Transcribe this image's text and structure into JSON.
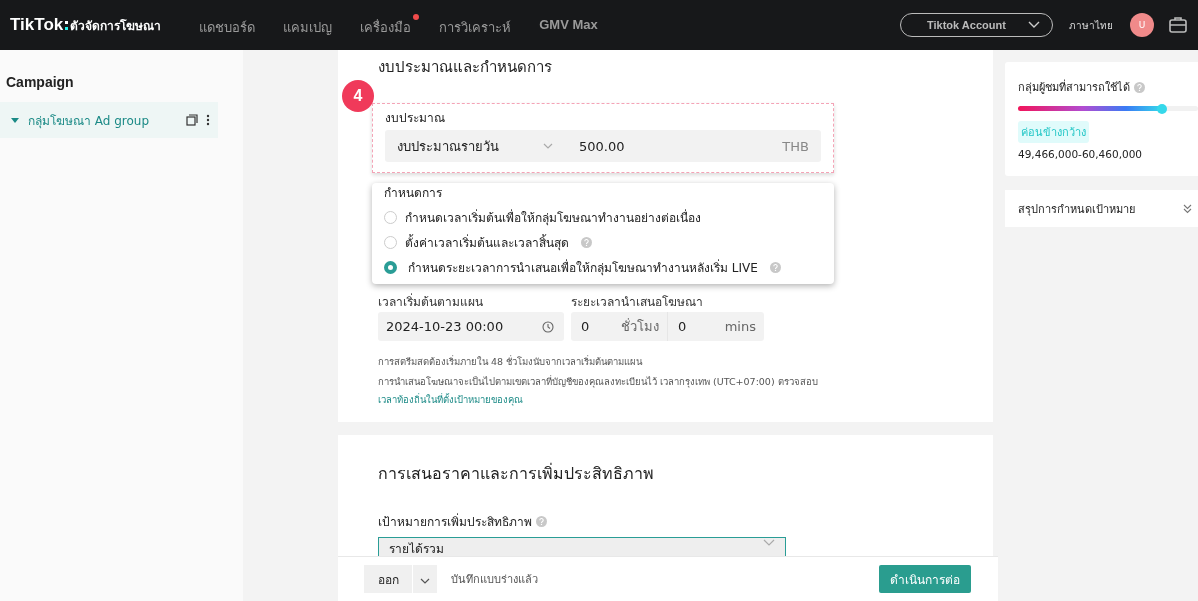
{
  "topbar": {
    "logo": "TikTok",
    "logo_suffix": "ตัวจัดการโฆษณา",
    "nav": [
      {
        "label": "แดชบอร์ด",
        "badge": false
      },
      {
        "label": "แคมเปญ",
        "badge": false
      },
      {
        "label": "เครื่องมือ",
        "badge": true
      },
      {
        "label": "การวิเคราะห์",
        "badge": false
      },
      {
        "label": "GMV Max",
        "badge": false
      }
    ],
    "account": "Tiktok Account",
    "language": "ภาษาไทย",
    "avatar": "U"
  },
  "sidebar": {
    "title": "Campaign",
    "items": [
      {
        "label": "กลุ่มโฆษณา Ad group",
        "expanded": true,
        "selected": true
      }
    ]
  },
  "budget_section": {
    "title": "งบประมาณและกำหนดการ",
    "step": "4",
    "budget": {
      "label": "งบประมาณ",
      "type": "งบประมาณรายวัน",
      "amount": "500.00",
      "currency": "THB"
    },
    "schedule": {
      "label": "กำหนดการ",
      "options": [
        {
          "label": "กำหนดเวลาเริ่มต้นเพื่อให้กลุ่มโฆษณาทำงานอย่างต่อเนื่อง",
          "selected": false,
          "help": false
        },
        {
          "label": "ตั้งค่าเวลาเริ่มต้นและเวลาสิ้นสุด",
          "selected": false,
          "help": true
        },
        {
          "label": "กำหนดระยะเวลาการนำเสนอเพื่อให้กลุ่มโฆษณาทำงานหลังเริ่ม LIVE",
          "selected": true,
          "help": true
        }
      ]
    },
    "start_time": {
      "label": "เวลาเริ่มต้นตามแผน",
      "value": "2024-10-23 00:00"
    },
    "duration": {
      "label": "ระยะเวลานำเสนอโฆษณา",
      "hours": "0",
      "hours_unit": "ชั่วโมง",
      "mins": "0",
      "mins_unit": "mins"
    },
    "note": "การสตรีมสดต้องเริ่มภายใน 48 ชั่วโมงนับจากเวลาเริ่มต้นตามแผน",
    "timezone_note": "การนำเสนอโฆษณาจะเป็นไปตามเขตเวลาที่บัญชีของคุณลงทะเบียนไว้ เวลากรุงเทพ (UTC+07:00) ตรวจสอบ",
    "timezone_link": "เวลาท้องถิ่นในที่ตั้งเป้าหมายของคุณ"
  },
  "bidding_section": {
    "title": "การเสนอราคาและการเพิ่มประสิทธิภาพ",
    "goal_label": "เป้าหมายการเพิ่มประสิทธิภาพ",
    "goal_value": "รายได้รวม"
  },
  "footer": {
    "exit": "ออก",
    "saved": "บันทึกแบบร่างแล้ว",
    "continue": "ดำเนินการต่อ"
  },
  "audience": {
    "title": "กลุ่มผู้ชมที่สามารถใช้ได้",
    "level": 0.8,
    "tag": "ค่อนข้างกว้าง",
    "range": "49,466,000-60,460,000"
  },
  "summary": {
    "title": "สรุปการกำหนดเป้าหมาย"
  }
}
